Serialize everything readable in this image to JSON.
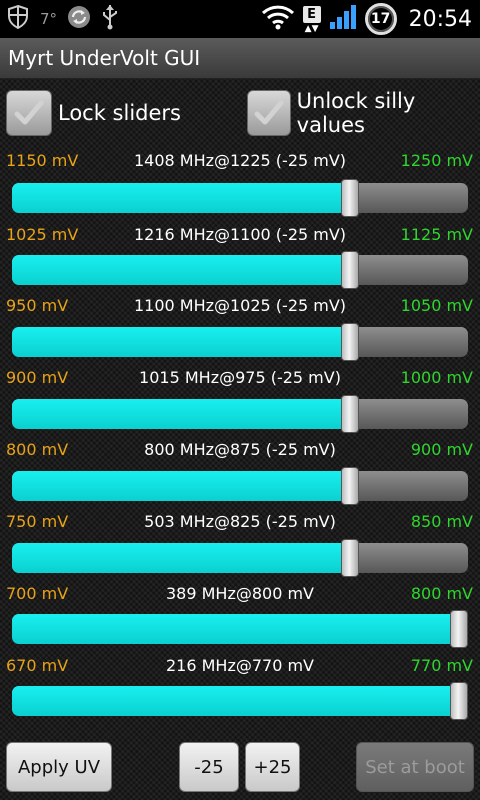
{
  "status_bar": {
    "temperature": "7°",
    "network_badge": "E",
    "battery_level": "17",
    "time": "20:54",
    "icons": [
      "shield-icon",
      "sync-icon",
      "usb-icon",
      "wifi-icon",
      "signal-icon",
      "battery-icon"
    ]
  },
  "app": {
    "title": "Myrt UnderVolt GUI"
  },
  "checkboxes": {
    "lock_sliders": {
      "label": "Lock sliders",
      "checked": true
    },
    "unlock_silly": {
      "label": "Unlock silly values",
      "checked": true
    }
  },
  "sliders": [
    {
      "min_label": "1150 mV",
      "freq_label": "1408 MHz@1225 (-25 mV)",
      "max_label": "1250 mV",
      "position": 0.75
    },
    {
      "min_label": "1025 mV",
      "freq_label": "1216 MHz@1100 (-25 mV)",
      "max_label": "1125 mV",
      "position": 0.75
    },
    {
      "min_label": "950 mV",
      "freq_label": "1100 MHz@1025 (-25 mV)",
      "max_label": "1050 mV",
      "position": 0.75
    },
    {
      "min_label": "900 mV",
      "freq_label": "1015 MHz@975 (-25 mV)",
      "max_label": "1000 mV",
      "position": 0.75
    },
    {
      "min_label": "800 mV",
      "freq_label": "800 MHz@875 (-25 mV)",
      "max_label": "900 mV",
      "position": 0.75
    },
    {
      "min_label": "750 mV",
      "freq_label": "503 MHz@825 (-25 mV)",
      "max_label": "850 mV",
      "position": 0.75
    },
    {
      "min_label": "700 mV",
      "freq_label": "389 MHz@800 mV",
      "max_label": "800 mV",
      "position": 1.0
    },
    {
      "min_label": "670 mV",
      "freq_label": "216 MHz@770 mV",
      "max_label": "770 mV",
      "position": 1.0
    }
  ],
  "buttons": {
    "apply": "Apply UV",
    "minus": "-25",
    "plus": "+25",
    "set_at_boot": "Set at boot"
  },
  "colors": {
    "min_label": "#e8a317",
    "max_label": "#2ed62e",
    "slider_fill": "#14e6e6"
  }
}
